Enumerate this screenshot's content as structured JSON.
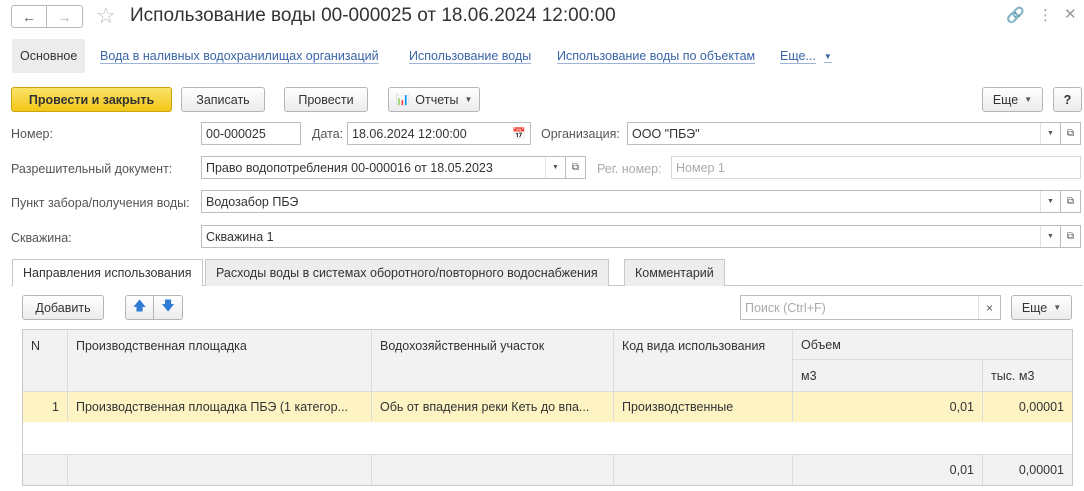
{
  "window": {
    "title": "Использование воды 00-000025 от 18.06.2024 12:00:00",
    "back_icon": "arrow-left-icon",
    "forward_icon": "arrow-right-icon"
  },
  "sections": {
    "active": "Основное",
    "links": [
      "Вода в наливных водохранилищах организаций",
      "Использование воды",
      "Использование воды по объектам",
      "Еще..."
    ]
  },
  "toolbar": {
    "post_close": "Провести и закрыть",
    "save": "Записать",
    "post": "Провести",
    "reports": "Отчеты",
    "more": "Еще",
    "help": "?"
  },
  "form": {
    "number_label": "Номер:",
    "number_value": "00-000025",
    "date_label": "Дата:",
    "date_value": "18.06.2024 12:00:00",
    "org_label": "Организация:",
    "org_value": "ООО \"ПБЭ\"",
    "permit_label": "Разрешительный документ:",
    "permit_value": "Право водопотребления 00-000016 от 18.05.2023",
    "reg_label": "Рег. номер:",
    "reg_placeholder": "Номер 1",
    "intake_label": "Пункт забора/получения воды:",
    "intake_value": "Водозабор ПБЭ",
    "well_label": "Скважина:",
    "well_value": "Скважина 1"
  },
  "tabs": [
    "Направления использования",
    "Расходы воды в системах оборотного/повторного водоснабжения",
    "Комментарий"
  ],
  "table_toolbar": {
    "add": "Добавить",
    "search_placeholder": "Поиск (Ctrl+F)",
    "more": "Еще"
  },
  "table": {
    "headers": {
      "n": "N",
      "site": "Производственная площадка",
      "section": "Водохозяйственный участок",
      "code": "Код вида использования",
      "volume": "Объем",
      "m3": "м3",
      "thousand_m3": "тыс. м3"
    },
    "rows": [
      {
        "n": "1",
        "site": "Производственная площадка ПБЭ (1 категор...",
        "section": "Обь от впадения реки Кеть до впа...",
        "code": "Производственные",
        "m3": "0,01",
        "thousand_m3": "0,00001"
      }
    ],
    "totals": {
      "m3": "0,01",
      "thousand_m3": "0,00001"
    }
  },
  "colors": {
    "accent": "#f1c716",
    "link": "#3a64a8",
    "selected_row": "#fdf3c3"
  }
}
